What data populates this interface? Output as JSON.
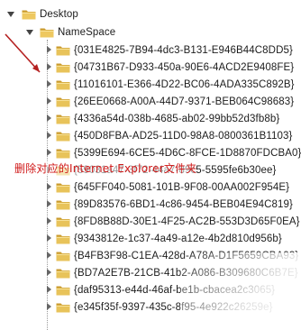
{
  "tree": {
    "root_label": "Desktop",
    "namespace_label": "NameSpace",
    "items": [
      {
        "label": "{031E4825-7B94-4dc3-B131-E946B44C8DD5}"
      },
      {
        "label": "{04731B67-D933-450a-90E6-4ACD2E9408FE}"
      },
      {
        "label": "{11016101-E366-4D22-BC06-4ADA335C892B}"
      },
      {
        "label": "{26EE0668-A00A-44D7-9371-BEB064C98683}"
      },
      {
        "label": "{4336a54d-038b-4685-ab02-99bb52d3fb8b}"
      },
      {
        "label": "{450D8FBA-AD25-11D0-98A8-0800361B1103}"
      },
      {
        "label": "{5399E694-6CE5-4D6C-8FCE-1D8870FDCBA0}"
      },
      {
        "label": "{59031a47-3f72-44a7-89c5-5595fe6b30ee}"
      },
      {
        "label": "{645FF040-5081-101B-9F08-00AA002F954E}"
      },
      {
        "label": "{89D83576-6BD1-4c86-9454-BEB04E94C819}"
      },
      {
        "label": "{8FD8B88D-30E1-4F25-AC2B-553D3D65F0EA}"
      },
      {
        "label": "{9343812e-1c37-4a49-a12e-4b2d810d956b}"
      },
      {
        "label": "{B4FB3F98-C1EA-428d-A78A-D1F5659CBA93}"
      },
      {
        "label": "{BD7A2E7B-21CB-41b2-A086-B309680C6B7E}"
      },
      {
        "label": "{daf95313-e44d-46af-be1b-cbacea2c3065}"
      },
      {
        "label": "{e345f35f-9397-435c-8f95-4e922c26259e}"
      }
    ]
  },
  "annotation": {
    "text": "删除对应的Internet Explorer文件夹",
    "color": "#d01818"
  },
  "icons": {
    "folder": "folder-icon",
    "expanded": "expanded-triangle-icon",
    "collapsed": "collapsed-triangle-icon"
  },
  "colors": {
    "folder_body": "#e8c35a",
    "folder_dark": "#c99a2e",
    "folder_light": "#f7e29a",
    "annotation_arrow": "#b52020"
  }
}
